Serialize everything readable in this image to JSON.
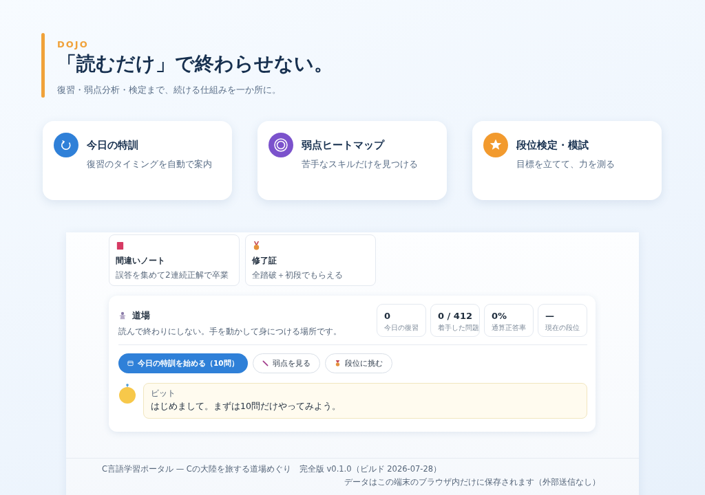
{
  "header": {
    "eyebrow": "DOJO",
    "title": "「読むだけ」で終わらせない。",
    "subtitle": "復習・弱点分析・検定まで、続ける仕組みを一か所に。"
  },
  "features": [
    {
      "kind": "refresh",
      "color": "#2f80d8",
      "title": "今日の特訓",
      "description": "復習のタイミングを自動で案内"
    },
    {
      "kind": "target",
      "color": "#7b52cc",
      "title": "弱点ヒートマップ",
      "description": "苦手なスキルだけを見つける"
    },
    {
      "kind": "star",
      "color": "#f29a2e",
      "title": "段位検定・模試",
      "description": "目標を立てて、力を測る"
    }
  ],
  "preview": {
    "tiles": [
      {
        "kind": "book",
        "title": "間違いノート",
        "description": "誤答を集めて2連続正解で卒業"
      },
      {
        "kind": "medal",
        "title": "修了証",
        "description": "全踏破＋初段でもらえる"
      }
    ],
    "dojo": {
      "title": "道場",
      "description": "読んで終わりにしない。手を動かして身につける場所です。",
      "stats": [
        {
          "value": "0",
          "label": "今日の復習"
        },
        {
          "value": "0 / 412",
          "label": "着手した問題"
        },
        {
          "value": "0%",
          "label": "通算正答率"
        },
        {
          "value": "—",
          "label": "現在の段位"
        }
      ],
      "actions": [
        {
          "kind": "primary",
          "label": "今日の特訓を始める（10問）"
        },
        {
          "kind": "weakness",
          "label": "弱点を見る"
        },
        {
          "kind": "rank",
          "label": "段位に挑む"
        }
      ],
      "message": {
        "speaker": "ビット",
        "text": "はじめまして。まずは10問だけやってみよう。"
      }
    },
    "footer": {
      "left": "C言語学習ポータル — Cの大陸を旅する道場めぐり　完全版 v0.1.0（ビルド 2026-07-28）",
      "right": "データはこの端末のブラウザ内だけに保存されます（外部送信なし）"
    }
  }
}
